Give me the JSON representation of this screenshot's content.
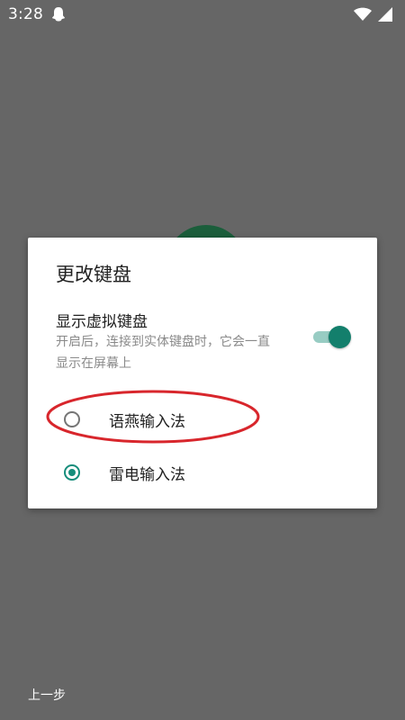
{
  "status_bar": {
    "time": "3:28",
    "app_icon": "ghost-icon",
    "wifi_icon": "wifi-icon",
    "battery_icon": "battery-icon"
  },
  "dialog": {
    "title": "更改键盘",
    "virtual_keyboard": {
      "title": "显示虚拟键盘",
      "description": "开启后，连接到实体键盘时，它会一直显示在屏幕上",
      "enabled": true
    },
    "options": [
      {
        "label": "语燕输入法",
        "selected": false
      },
      {
        "label": "雷电输入法",
        "selected": true
      }
    ]
  },
  "footer": {
    "back_label": "上一步"
  },
  "colors": {
    "background": "#666666",
    "accent": "#168d7b",
    "annotation": "#d8262c"
  }
}
